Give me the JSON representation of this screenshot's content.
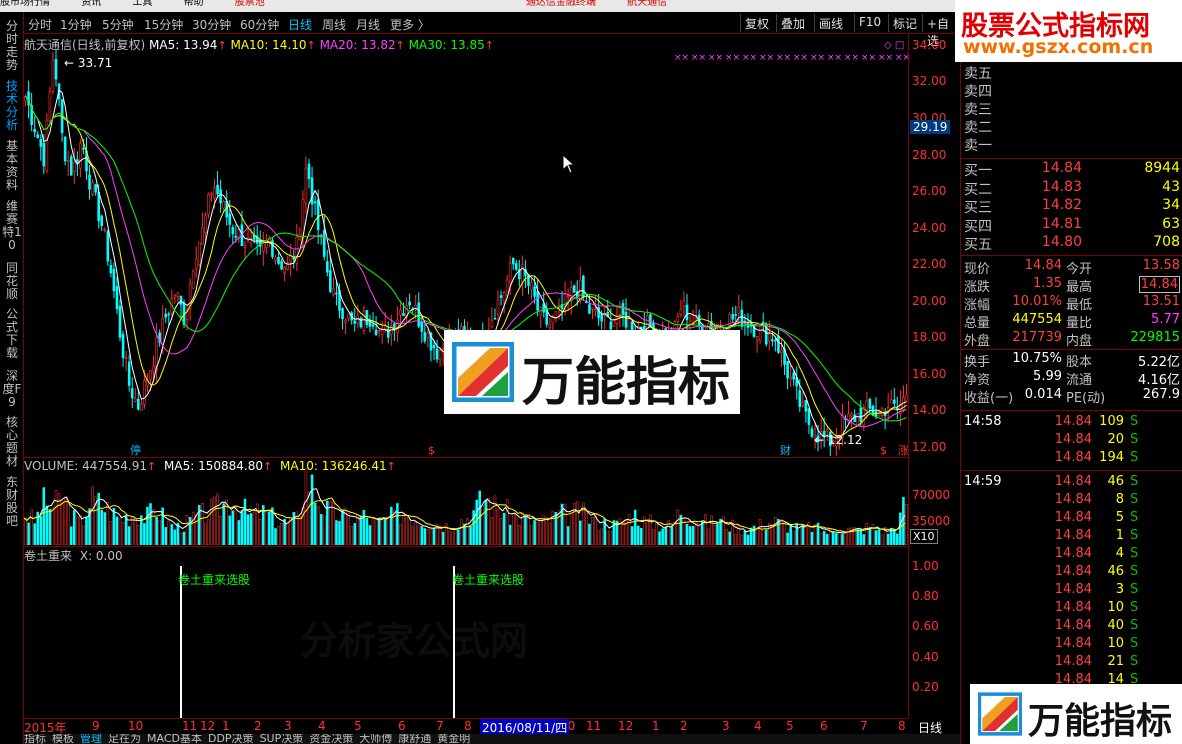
{
  "menubar": {
    "items": [
      "股市场行情",
      "资讯",
      "工具",
      "帮助",
      "股票池"
    ],
    "center_items": [
      "通达信金融终端",
      "航天通信"
    ]
  },
  "left_tabs": [
    {
      "label": "分时走势",
      "active": false
    },
    {
      "label": "技术分析",
      "active": true
    },
    {
      "label": "基本资料",
      "active": false
    },
    {
      "label": "维赛特10",
      "active": false
    },
    {
      "label": "同花顺",
      "active": false
    },
    {
      "label": "公式下载",
      "active": false
    },
    {
      "label": "深度F9",
      "active": false
    },
    {
      "label": "核心题材",
      "active": false
    },
    {
      "label": "东财股吧",
      "active": false
    }
  ],
  "toolbar": {
    "periods": [
      "分时",
      "1分钟",
      "5分钟",
      "15分钟",
      "30分钟",
      "60分钟",
      "日线",
      "周线",
      "月线",
      "更多 〉"
    ],
    "active_period": "日线",
    "buttons": [
      "复权",
      "叠加",
      "画线",
      "F10",
      "标记",
      "+自选"
    ]
  },
  "price_chart": {
    "title": "航天通信(日线,前复权)",
    "ma5": "MA5: 13.94",
    "ma10": "MA10: 14.10",
    "ma20": "MA20: 13.82",
    "ma30": "MA30: 13.85",
    "colors": {
      "ma5": "#ffffff",
      "ma10": "#ffff00",
      "ma20": "#ff40ff",
      "ma30": "#00ff00",
      "up": "#ff3030",
      "down": "#00ffff"
    },
    "high_label": "33.71",
    "low_label": "12.12",
    "current_price_box": "29.19",
    "y_ticks": [
      "34.00",
      "32.00",
      "30.00",
      "28.00",
      "26.00",
      "24.00",
      "22.00",
      "20.00",
      "18.00",
      "16.00",
      "14.00",
      "12.00"
    ],
    "ylim": [
      11.5,
      34.6
    ],
    "stamps": [
      {
        "text": "停",
        "color": "#00c0ff"
      },
      {
        "text": "$",
        "color": "#ff3030"
      },
      {
        "text": "财",
        "color": "#00c0ff"
      },
      {
        "text": "$",
        "color": "#ff3030"
      },
      {
        "text": "涨",
        "color": "#ff3030"
      }
    ]
  },
  "chart_data": {
    "type": "candlestick",
    "close_path": [
      31.2,
      29.5,
      27.8,
      33.7,
      28.5,
      27.0,
      28.8,
      26.2,
      24.5,
      22.0,
      18.5,
      15.5,
      14.2,
      15.8,
      17.5,
      19.2,
      20.5,
      19.0,
      22.5,
      24.0,
      26.5,
      25.2,
      24.0,
      23.5,
      23.0,
      22.5,
      23.4,
      22.2,
      21.8,
      23.0,
      27.5,
      24.5,
      22.0,
      20.0,
      19.5,
      18.5,
      19.0,
      19.2,
      18.0,
      18.6,
      19.5,
      20.1,
      19.0,
      18.0,
      17.2,
      17.6,
      17.9,
      18.2,
      17.5,
      18.0,
      19.5,
      20.5,
      22.0,
      21.5,
      20.5,
      19.0,
      18.7,
      19.3,
      20.2,
      20.8,
      19.5,
      19.1,
      18.8,
      19.2,
      19.0,
      18.5,
      18.7,
      18.5,
      18.0,
      17.8,
      19.8,
      19.0,
      18.5,
      18.8,
      18.7,
      18.9,
      19.2,
      18.9,
      18.5,
      18.2,
      18.0,
      16.5,
      15.2,
      13.8,
      13.0,
      12.5,
      12.3,
      13.2,
      13.5,
      13.8,
      14.0,
      13.8,
      14.3,
      14.0,
      14.84
    ]
  },
  "volume_chart": {
    "title": "VOLUME: 447554.91",
    "ma5": "MA5: 150884.80",
    "ma10": "MA10: 136246.41",
    "y_ticks": [
      "70000",
      "35000"
    ],
    "unit": "X10",
    "bars": [
      40,
      30,
      55,
      48,
      62,
      35,
      28,
      60,
      52,
      45,
      33,
      38,
      41,
      36,
      48,
      30,
      22,
      26,
      35,
      40,
      44,
      52,
      60,
      48,
      36,
      42,
      38,
      30,
      28,
      34,
      95,
      62,
      45,
      40,
      36,
      33,
      38,
      30,
      28,
      35,
      42,
      38,
      33,
      30,
      28,
      25,
      30,
      34,
      45,
      62,
      50,
      44,
      38,
      35,
      30,
      28,
      33,
      40,
      38,
      42,
      36,
      30,
      28,
      25,
      33,
      40,
      30,
      28,
      26,
      24,
      48,
      36,
      30,
      28,
      32,
      26,
      22,
      20,
      24,
      28,
      30,
      26,
      22,
      20,
      24,
      18,
      16,
      22,
      20,
      18,
      24,
      20,
      18,
      22,
      60
    ]
  },
  "indicator_chart": {
    "title": "卷土重来",
    "x_value": "X: 0.00",
    "signal_label": "卷土重来选股",
    "y_ticks": [
      "1.00",
      "0.80",
      "0.60",
      "0.40",
      "0.20"
    ]
  },
  "date_axis": {
    "labels": [
      "2015年",
      "9",
      "10",
      "11",
      "12",
      "1",
      "2",
      "3",
      "4",
      "5",
      "6",
      "7",
      "8",
      "10",
      "11",
      "12",
      "1",
      "2",
      "3",
      "4",
      "5",
      "6",
      "7",
      "8"
    ],
    "highlight": "2016/08/11/四",
    "period": "日线"
  },
  "bottom_tabs": [
    "指标",
    "模板",
    "管理",
    "足在为",
    "MACD基本",
    "DDP决策",
    "SUP决策",
    "资金决策",
    "大师傅",
    "康舒通",
    "黄金明"
  ],
  "bottom_active": "管理",
  "right_panel": {
    "sell": [
      {
        "label": "卖五"
      },
      {
        "label": "卖四"
      },
      {
        "label": "卖三"
      },
      {
        "label": "卖二"
      },
      {
        "label": "卖一"
      }
    ],
    "buy": [
      {
        "label": "买一",
        "price": "14.84",
        "vol": "8944"
      },
      {
        "label": "买二",
        "price": "14.83",
        "vol": "43"
      },
      {
        "label": "买三",
        "price": "14.82",
        "vol": "34"
      },
      {
        "label": "买四",
        "price": "14.81",
        "vol": "63"
      },
      {
        "label": "买五",
        "price": "14.80",
        "vol": "708"
      }
    ],
    "quote": [
      {
        "l1": "现价",
        "v1": "14.84",
        "l2": "今开",
        "v2": "13.58",
        "c1": "#ff4040",
        "c2": "#ff4040"
      },
      {
        "l1": "涨跌",
        "v1": "1.35",
        "l2": "最高",
        "v2": "14.84",
        "c1": "#ff4040",
        "c2": "#ff4040"
      },
      {
        "l1": "涨幅",
        "v1": "10.01%",
        "l2": "最低",
        "v2": "13.51",
        "c1": "#ff4040",
        "c2": "#ff4040"
      },
      {
        "l1": "总量",
        "v1": "447554",
        "l2": "量比",
        "v2": "5.77",
        "c1": "#ffff00",
        "c2": "#ff40ff"
      },
      {
        "l1": "外盘",
        "v1": "217739",
        "l2": "内盘",
        "v2": "229815",
        "c1": "#ff4040",
        "c2": "#00ff00"
      },
      {
        "l1": "换手",
        "v1": "10.75%",
        "l2": "股本",
        "v2": "5.22亿",
        "c1": "#ffffff",
        "c2": "#ffffff"
      },
      {
        "l1": "净资",
        "v1": "5.99",
        "l2": "流通",
        "v2": "4.16亿",
        "c1": "#ffffff",
        "c2": "#ffffff"
      },
      {
        "l1": "收益(一)",
        "v1": "0.014",
        "l2": "PE(动)",
        "v2": "267.9",
        "c1": "#ffffff",
        "c2": "#ffffff"
      }
    ],
    "ticks": [
      {
        "time": "14:58",
        "price": "14.84",
        "vol": "109",
        "side": "S"
      },
      {
        "time": "",
        "price": "14.84",
        "vol": "20",
        "side": "S"
      },
      {
        "time": "",
        "price": "14.84",
        "vol": "194",
        "side": "S"
      },
      {
        "time": "14:59",
        "price": "14.84",
        "vol": "46",
        "side": "S"
      },
      {
        "time": "",
        "price": "14.84",
        "vol": "8",
        "side": "S"
      },
      {
        "time": "",
        "price": "14.84",
        "vol": "5",
        "side": "S"
      },
      {
        "time": "",
        "price": "14.84",
        "vol": "1",
        "side": "S"
      },
      {
        "time": "",
        "price": "14.84",
        "vol": "4",
        "side": "S"
      },
      {
        "time": "",
        "price": "14.84",
        "vol": "46",
        "side": "S"
      },
      {
        "time": "",
        "price": "14.84",
        "vol": "3",
        "side": "S"
      },
      {
        "time": "",
        "price": "14.84",
        "vol": "10",
        "side": "S"
      },
      {
        "time": "",
        "price": "14.84",
        "vol": "40",
        "side": "S"
      },
      {
        "time": "",
        "price": "14.84",
        "vol": "10",
        "side": "S"
      },
      {
        "time": "",
        "price": "14.84",
        "vol": "21",
        "side": "S"
      },
      {
        "time": "",
        "price": "14.84",
        "vol": "14",
        "side": "S"
      }
    ]
  },
  "logos": {
    "top_title": "股票公式指标网",
    "top_url": "www.gszx.com.cn",
    "wanneng": "万能指标",
    "ghost_watermark": "分析家公式网"
  }
}
